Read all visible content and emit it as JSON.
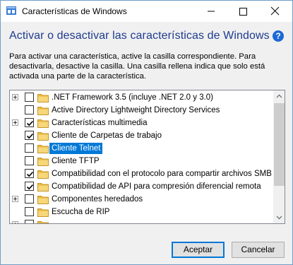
{
  "window": {
    "title": "Características de Windows",
    "heading": "Activar o desactivar las características de Windows",
    "description": "Para activar una característica, active la casilla correspondiente. Para desactivarla, desactive la casilla. Una casilla rellena indica que solo está activada una parte de la característica."
  },
  "colors": {
    "heading": "#1e3b8e",
    "selection": "#0078d7",
    "folder": "#e8b93e",
    "help": "#1c69d3"
  },
  "features": [
    {
      "label": ".NET Framework 3.5 (incluye .NET 2.0 y 3.0)",
      "expandable": true,
      "state": "unchecked",
      "selected": false
    },
    {
      "label": "Active Directory Lightweight Directory Services",
      "expandable": false,
      "state": "unchecked",
      "selected": false
    },
    {
      "label": "Características multimedia",
      "expandable": true,
      "state": "checked",
      "selected": false
    },
    {
      "label": "Cliente de Carpetas de trabajo",
      "expandable": false,
      "state": "checked",
      "selected": false
    },
    {
      "label": "Cliente Telnet",
      "expandable": false,
      "state": "unchecked",
      "selected": true
    },
    {
      "label": "Cliente TFTP",
      "expandable": false,
      "state": "unchecked",
      "selected": false
    },
    {
      "label": "Compatibilidad con el protocolo para compartir archivos SMB",
      "expandable": false,
      "state": "checked",
      "selected": false
    },
    {
      "label": "Compatibilidad de API para compresión diferencial remota",
      "expandable": false,
      "state": "checked",
      "selected": false
    },
    {
      "label": "Componentes heredados",
      "expandable": true,
      "state": "unchecked",
      "selected": false
    },
    {
      "label": "Escucha de RIP",
      "expandable": false,
      "state": "unchecked",
      "selected": false
    },
    {
      "label": "",
      "expandable": true,
      "state": "unchecked",
      "selected": false
    }
  ],
  "buttons": {
    "accept": "Aceptar",
    "cancel": "Cancelar"
  },
  "icons": {
    "app": "windows-features-icon",
    "help": "help-icon",
    "minimize": "minimize-icon",
    "maximize": "maximize-icon",
    "close": "close-icon"
  }
}
